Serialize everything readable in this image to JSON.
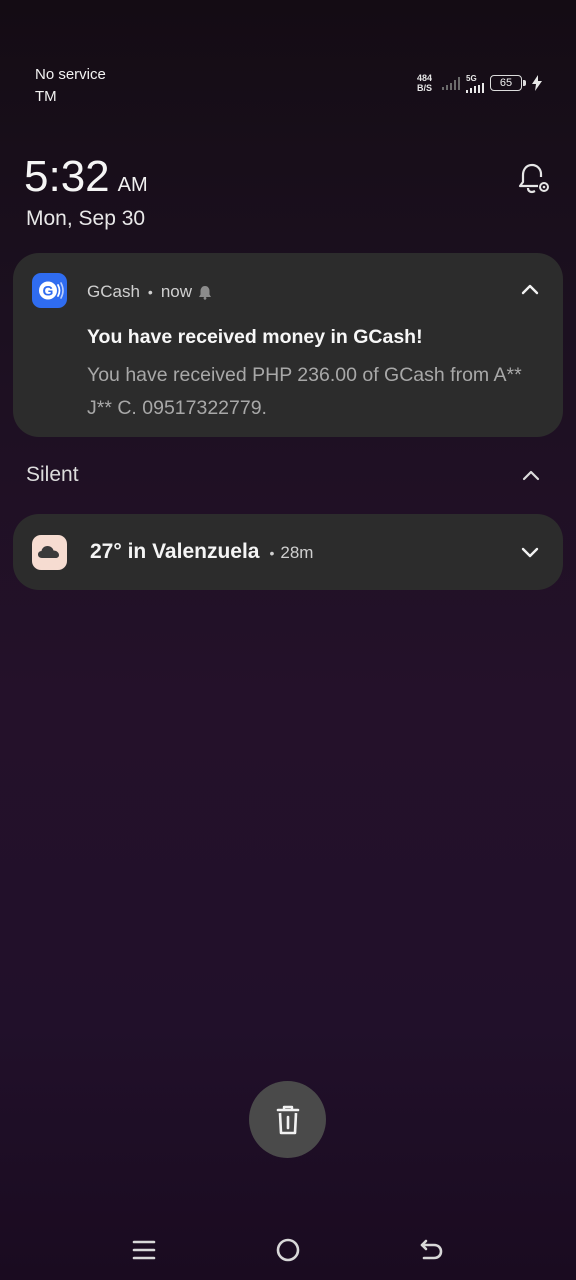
{
  "status_bar": {
    "carrier_line1": "No service",
    "carrier_line2": "TM",
    "net_speed_value": "484",
    "net_speed_unit": "B/S",
    "network_type": "5G",
    "battery_level": "65",
    "charging": true
  },
  "lockscreen": {
    "time": "5:32",
    "ampm": "AM",
    "date": "Mon, Sep 30"
  },
  "notifications": {
    "gcash": {
      "app_name": "GCash",
      "separator": "•",
      "time": "now",
      "title": "You have received money in GCash!",
      "body": "You have received PHP 236.00 of GCash from A** J** C. 09517322779.",
      "icon": "gcash-logo-icon",
      "icon_color": "#2f6cf0"
    },
    "silent_section": {
      "label": "Silent"
    },
    "weather": {
      "title": "27° in Valenzuela",
      "separator": "•",
      "time": "28m",
      "icon": "cloud-icon",
      "icon_color": "#f6dcd1"
    }
  },
  "actions": {
    "clear_all_icon": "trash-icon"
  },
  "nav_bar": {
    "items": [
      "menu-icon",
      "home-icon",
      "back-icon"
    ]
  },
  "colors": {
    "card_background": "#2c2c2c",
    "clear_button": "#4a4a4a"
  }
}
